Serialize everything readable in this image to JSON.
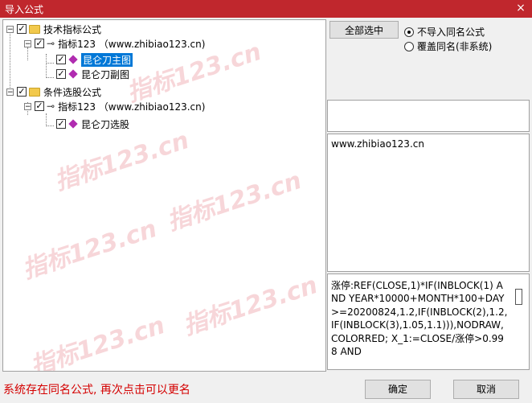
{
  "window": {
    "title": "导入公式",
    "close_glyph": "×"
  },
  "watermark": {
    "text": "指标123.cn"
  },
  "tree": {
    "nodes": [
      {
        "id": "cat1",
        "label": "技术指标公式",
        "expander": "−"
      },
      {
        "id": "src1",
        "label": "指标123 （www.zhibiao123.cn)",
        "expander": "−"
      },
      {
        "id": "f1",
        "label": "昆仑刀主图",
        "selected": true
      },
      {
        "id": "f2",
        "label": "昆仑刀副图"
      },
      {
        "id": "cat2",
        "label": "条件选股公式",
        "expander": "−"
      },
      {
        "id": "src2",
        "label": "指标123 （www.zhibiao123.cn)",
        "expander": "−"
      },
      {
        "id": "f3",
        "label": "昆仑刀选股"
      }
    ],
    "check_glyph": "✓",
    "key_glyph": "⊸"
  },
  "options": {
    "select_all_label": "全部选中",
    "radio_no_import": "不导入同名公式",
    "radio_overwrite": "覆盖同名(非系统)"
  },
  "info": {
    "text": "www.zhibiao123.cn"
  },
  "code": {
    "text": "涨停:REF(CLOSE,1)*IF(INBLOCK(1) AND YEAR*10000+MONTH*100+DAY>=20200824,1.2,IF(INBLOCK(2),1.2,IF(INBLOCK(3),1.05,1.1))),NODRAW,COLORRED; X_1:=CLOSE/涨停>0.998 AND"
  },
  "status": {
    "message": "系统存在同名公式, 再次点击可以更名"
  },
  "buttons": {
    "ok": "确定",
    "cancel": "取消"
  }
}
